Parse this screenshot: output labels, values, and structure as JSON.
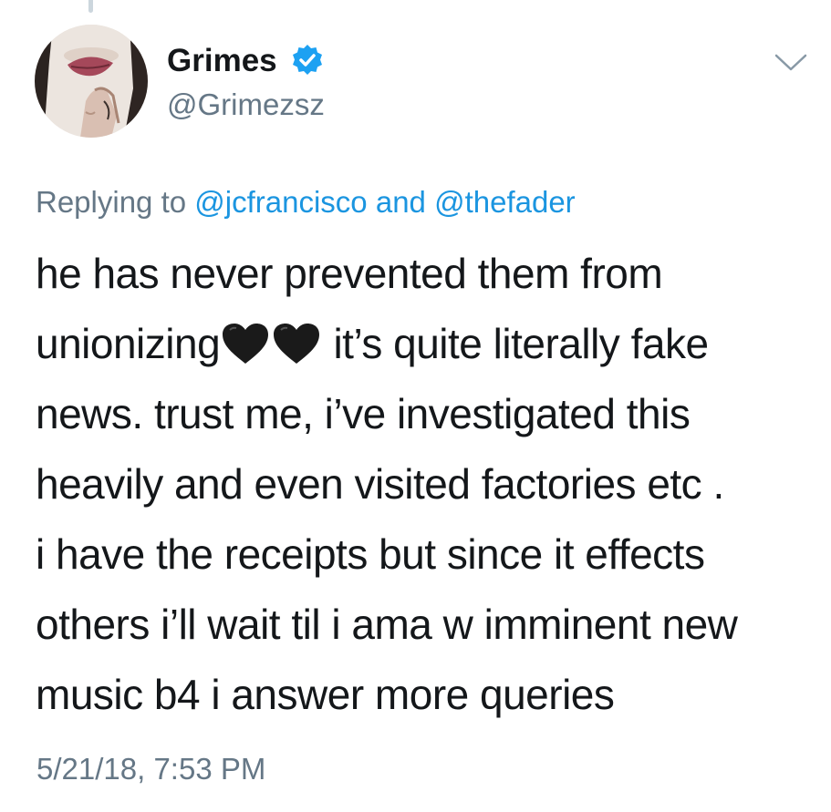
{
  "tweet": {
    "author": {
      "display_name": "Grimes",
      "handle": "@Grimezsz",
      "verified": true,
      "avatar_icon": "profile-photo"
    },
    "reply_context": {
      "prefix": "Replying to",
      "mention_1": "@jcfrancisco",
      "joiner": "and",
      "mention_2": "@thefader"
    },
    "text_lines": {
      "line_1": "he has never prevented them from",
      "line_2_before": "unionizing",
      "line_2_after": "it’s quite literally fake",
      "line_3": "news.  trust me, i’ve investigated this",
      "line_4": "heavily and even visited factories etc .",
      "line_5": "i have the receipts but since it effects",
      "line_6": "others i’ll wait til i ama w imminent new",
      "line_7": "music b4 i answer more queries"
    },
    "emoji": [
      "black-heart-icon",
      "black-heart-icon"
    ],
    "timestamp": "5/21/18, 7:53 PM"
  },
  "colors": {
    "text": "#14171a",
    "secondary": "#657786",
    "link": "#1b95e0",
    "verified": "#1da1f2"
  }
}
